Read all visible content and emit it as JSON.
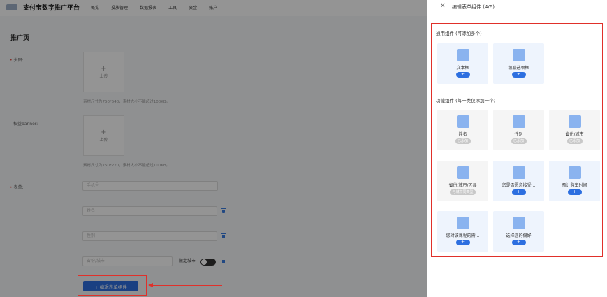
{
  "header": {
    "brand": "支付宝数字推广平台",
    "nav": [
      "概览",
      "投放管理",
      "数据报表",
      "工具",
      "资金",
      "账户"
    ]
  },
  "page": {
    "title": "推广页",
    "avatar_label": "头图:",
    "banner_label": "权益banner:",
    "form_label": "表单:",
    "upload_text": "上传",
    "hint1": "素材尺寸为750*540，素材大小不能超过100KB。",
    "hint2": "素材尺寸为750*220，素材大小不能超过100KB。",
    "fields": [
      "手机号",
      "姓名",
      "性别",
      "省份/城市"
    ],
    "limit_city_label": "限定城市",
    "edit_button": "+ 编辑表单组件"
  },
  "drawer": {
    "title": "编辑表单组件 (4/6)",
    "general_title": "通用组件 (可添加多个)",
    "function_title": "功能组件 (每一类仅添加一个)",
    "general_cards": [
      {
        "label": "文本框",
        "action": "+"
      },
      {
        "label": "级联选项框",
        "action": "+"
      }
    ],
    "function_cards": [
      {
        "label": "姓名",
        "action": "已添加"
      },
      {
        "label": "性别",
        "action": "已添加"
      },
      {
        "label": "省份/城市",
        "action": "已添加"
      },
      {
        "label": "省份/城市/区县",
        "action": "与城市同类型"
      },
      {
        "label": "您是否愿意接受...",
        "action": "+"
      },
      {
        "label": "预计购车时间",
        "action": "+"
      },
      {
        "label": "您对该课程的需...",
        "action": "+"
      },
      {
        "label": "选择您的偏好",
        "action": "+"
      }
    ]
  },
  "colors": {
    "accent": "#2d6fe0",
    "annotation_red": "#e0302a"
  }
}
